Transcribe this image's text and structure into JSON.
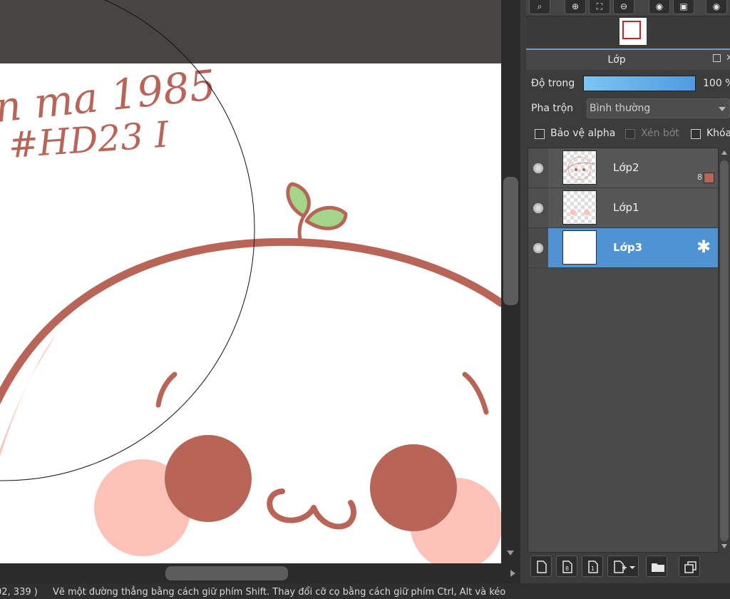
{
  "canvas": {
    "handwriting_line1": "n ma 1985",
    "handwriting_line2": "#HD23 I",
    "colors": {
      "outline": "#b86456",
      "cheek": "#fcc2b8",
      "leaf": "#a3d58a",
      "background": "#474543",
      "paper": "#ffffff"
    }
  },
  "navigator": {
    "tool_icons": [
      "zoom-icon",
      "zoom-in-icon",
      "fit-icon",
      "zoom-out-icon",
      "rotate-left-icon",
      "flip-icon",
      "rotate-right-icon"
    ]
  },
  "layer_panel": {
    "title": "Lớp",
    "opacity_label": "Độ trong",
    "opacity_value": "100 %",
    "opacity_percent": 100,
    "blend_label": "Pha trộn",
    "blend_value": "Bình thường",
    "protect_alpha_label": "Bảo vệ alpha",
    "clipping_label": "Xén bớt",
    "lock_label": "Khóa",
    "layers": [
      {
        "name": "Lớp2",
        "count": "8",
        "swatch_color": "#b86456",
        "selected": false
      },
      {
        "name": "Lớp1",
        "selected": false
      },
      {
        "name": "Lớp3",
        "selected": true
      }
    ],
    "accent_color": "#4f93d2"
  },
  "status": {
    "coords": "02, 339 )",
    "hint": "Vẽ một đường thẳng bằng cách giữ phím Shift. Thay đổi cỡ cọ bằng cách giữ phím Ctrl, Alt và kéo"
  }
}
